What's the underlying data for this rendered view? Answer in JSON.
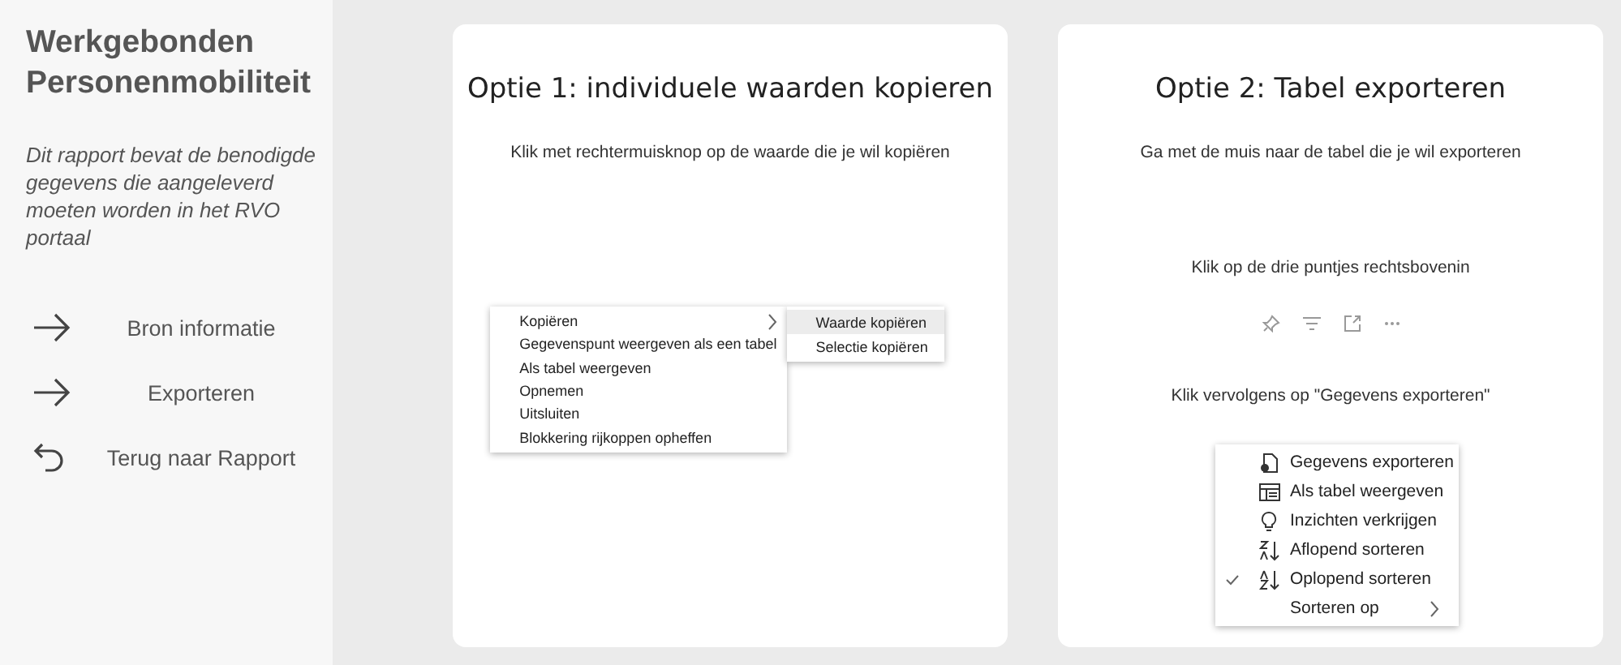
{
  "sidebar": {
    "title": "Werkgebonden Personenmobiliteit",
    "description": "Dit rapport bevat de benodigde gegevens die aangeleverd moeten worden in het RVO portaal",
    "nav": [
      {
        "label": "Bron informatie",
        "kind": "forward"
      },
      {
        "label": "Exporteren",
        "kind": "forward"
      },
      {
        "label": "Terug naar Rapport",
        "kind": "back"
      }
    ]
  },
  "cards": [
    {
      "title": "Optie 1: individuele waarden kopieren",
      "blocks": [
        {
          "kind": "text",
          "text": "Klik met rechtermuisknop op de waarde die je wil kopiëren"
        },
        {
          "kind": "menu",
          "items": [
            {
              "label": "Kopiëren",
              "submenu": true
            },
            {
              "label": "Gegevenspunt weergeven als een tabel",
              "submenu": false
            },
            {
              "label": "Als tabel weergeven",
              "submenu": false
            },
            {
              "label": "Opnemen",
              "submenu": false
            },
            {
              "label": "Uitsluiten",
              "submenu": false
            },
            {
              "label": "Blokkering rijkoppen opheffen",
              "submenu": false
            }
          ],
          "subitems": [
            {
              "label": "Waarde kopiëren",
              "selected": true
            },
            {
              "label": "Selectie kopiëren",
              "selected": false
            }
          ]
        }
      ]
    },
    {
      "title": "Optie 2: Tabel exporteren",
      "blocks": [
        {
          "kind": "text",
          "text": "Ga met de muis naar de tabel die je wil exporteren"
        },
        {
          "kind": "text",
          "text": "Klik op de drie puntjes rechtsbovenin"
        },
        {
          "kind": "toolbar"
        },
        {
          "kind": "text",
          "text": "Klik vervolgens op \"Gegevens exporteren\""
        },
        {
          "kind": "menu",
          "items": [
            {
              "label": "Gegevens exporteren",
              "checked": false,
              "submenu": false
            },
            {
              "label": "Als tabel weergeven",
              "checked": false,
              "submenu": false
            },
            {
              "label": "Inzichten verkrijgen",
              "checked": false,
              "submenu": false
            },
            {
              "label": "Aflopend sorteren",
              "checked": false,
              "submenu": false
            },
            {
              "label": "Oplopend sorteren",
              "checked": true,
              "submenu": false
            },
            {
              "label": "Sorteren op",
              "checked": false,
              "submenu": true
            }
          ]
        }
      ]
    }
  ]
}
